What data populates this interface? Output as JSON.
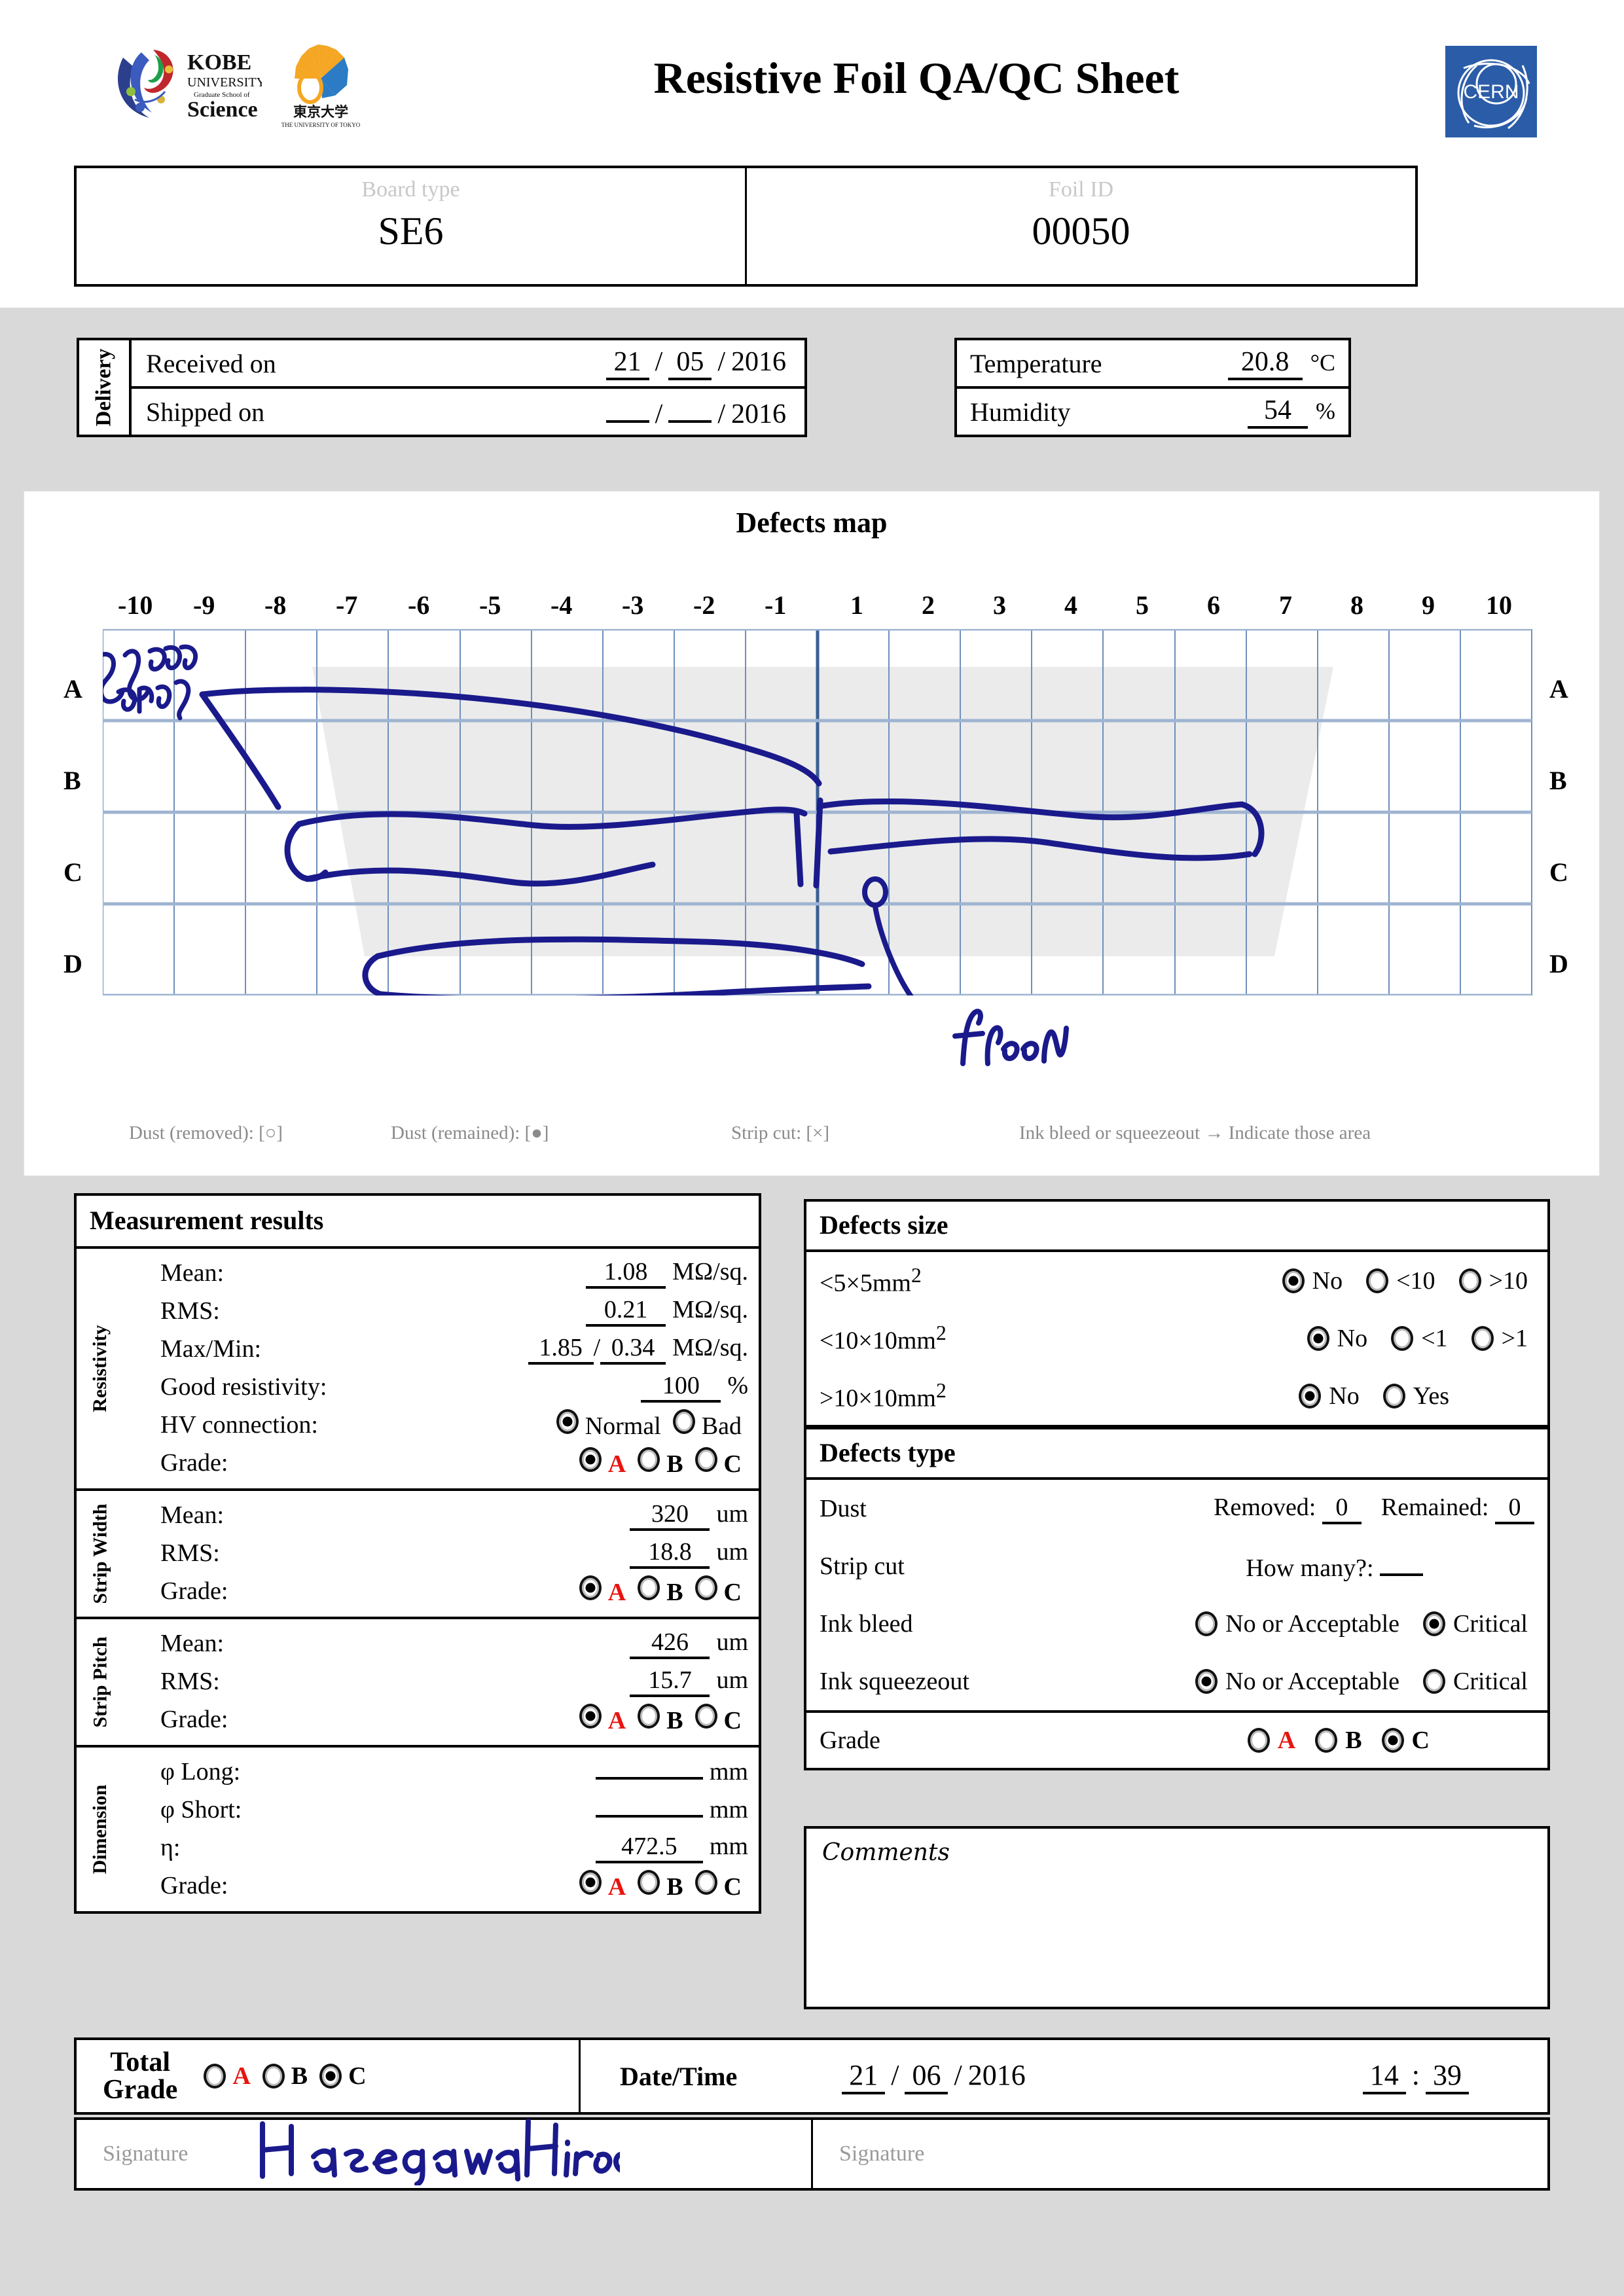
{
  "header": {
    "title": "Resistive Foil QA/QC Sheet",
    "logos": {
      "kobe": "KOBE UNIVERSITY Graduate School of Science",
      "tokyo": "THE UNIVERSITY OF TOKYO",
      "cern": "CERN"
    }
  },
  "identification": {
    "board_type_label": "Board type",
    "board_type_value": "SE6",
    "foil_id_label": "Foil ID",
    "foil_id_value": "00050"
  },
  "delivery": {
    "tab_label": "Delivery",
    "received_label": "Received on",
    "received_day": "21",
    "received_month": "05",
    "received_year": "2016",
    "shipped_label": "Shipped on",
    "shipped_day": "",
    "shipped_month": "",
    "shipped_year": "2016"
  },
  "environment": {
    "temperature_label": "Temperature",
    "temperature_value": "20.8",
    "temperature_unit": "°C",
    "humidity_label": "Humidity",
    "humidity_value": "54",
    "humidity_unit": "%"
  },
  "defects_map": {
    "title": "Defects map",
    "columns": [
      "-10",
      "-9",
      "-8",
      "-7",
      "-6",
      "-5",
      "-4",
      "-3",
      "-2",
      "-1",
      "1",
      "2",
      "3",
      "4",
      "5",
      "6",
      "7",
      "8",
      "9",
      "10"
    ],
    "rows": [
      "A",
      "B",
      "C",
      "D"
    ],
    "legend": [
      "Dust (removed): [○]",
      "Dust (remained): [●]",
      "Strip cut: [×]",
      "Ink bleed or squeezeout → Indicate those area"
    ],
    "annotations": [
      {
        "text": "squeeze out",
        "position": "row-A-left"
      },
      {
        "text": "fleen",
        "position": "below-row-D-center"
      }
    ]
  },
  "measurement": {
    "heading": "Measurement results",
    "resistivity": {
      "tab_label": "Resistivity",
      "mean_label": "Mean:",
      "mean_value": "1.08",
      "mean_unit": "MΩ/sq.",
      "rms_label": "RMS:",
      "rms_value": "0.21",
      "rms_unit": "MΩ/sq.",
      "maxmin_label": "Max/Min:",
      "max_value": "1.85",
      "min_value": "0.34",
      "maxmin_unit": "MΩ/sq.",
      "good_label": "Good resistivity:",
      "good_value": "100",
      "good_unit": "%",
      "hv_label": "HV connection:",
      "hv_options": [
        "Normal",
        "Bad"
      ],
      "hv_selected": "Normal",
      "grade_label": "Grade:",
      "grade_options": [
        "A",
        "B",
        "C"
      ],
      "grade_selected": "A"
    },
    "strip_width": {
      "tab_label": "Strip Width",
      "mean_label": "Mean:",
      "mean_value": "320",
      "mean_unit": "um",
      "rms_label": "RMS:",
      "rms_value": "18.8",
      "rms_unit": "um",
      "grade_label": "Grade:",
      "grade_options": [
        "A",
        "B",
        "C"
      ],
      "grade_selected": "A"
    },
    "strip_pitch": {
      "tab_label": "Strip Pitch",
      "mean_label": "Mean:",
      "mean_value": "426",
      "mean_unit": "um",
      "rms_label": "RMS:",
      "rms_value": "15.7",
      "rms_unit": "um",
      "grade_label": "Grade:",
      "grade_options": [
        "A",
        "B",
        "C"
      ],
      "grade_selected": "A"
    },
    "dimension": {
      "tab_label": "Dimension",
      "long_label": "φ Long:",
      "long_value": "",
      "long_unit": "mm",
      "short_label": "φ Short:",
      "short_value": "",
      "short_unit": "mm",
      "eta_label": "η:",
      "eta_value": "472.5",
      "eta_unit": "mm",
      "grade_label": "Grade:",
      "grade_options": [
        "A",
        "B",
        "C"
      ],
      "grade_selected": "A"
    }
  },
  "defects_size": {
    "heading": "Defects size",
    "rows": [
      {
        "label": "<5×5mm",
        "sup": "2",
        "options": [
          "No",
          "<10",
          ">10"
        ],
        "selected": "No"
      },
      {
        "label": "<10×10mm",
        "sup": "2",
        "options": [
          "No",
          "<1",
          ">1"
        ],
        "selected": "No"
      },
      {
        "label": ">10×10mm",
        "sup": "2",
        "options": [
          "No",
          "Yes"
        ],
        "selected": "No"
      }
    ]
  },
  "defects_type": {
    "heading": "Defects type",
    "dust_label": "Dust",
    "dust_removed_label": "Removed:",
    "dust_removed_value": "0",
    "dust_remained_label": "Remained:",
    "dust_remained_value": "0",
    "stripcut_label": "Strip cut",
    "stripcut_howmany_label": "How many?:",
    "stripcut_howmany_value": "",
    "inkbleed_label": "Ink bleed",
    "inkbleed_options": [
      "No or Acceptable",
      "Critical"
    ],
    "inkbleed_selected": "Critical",
    "inksqueeze_label": "Ink squeezeout",
    "inksqueeze_options": [
      "No or Acceptable",
      "Critical"
    ],
    "inksqueeze_selected": "No or Acceptable",
    "grade_label": "Grade",
    "grade_options": [
      "A",
      "B",
      "C"
    ],
    "grade_selected": "C"
  },
  "comments": {
    "label": "Comments",
    "value": ""
  },
  "footer": {
    "total_grade_line1": "Total",
    "total_grade_line2": "Grade",
    "total_grade_options": [
      "A",
      "B",
      "C"
    ],
    "total_grade_selected": "C",
    "datetime_label": "Date/Time",
    "date_day": "21",
    "date_month": "06",
    "date_year": "2016",
    "time_hour": "14",
    "time_minute": "39",
    "signature_label_left": "Signature",
    "signature_value_left": "Hasegawa Hiroki",
    "signature_label_right": "Signature",
    "signature_value_right": ""
  },
  "colors": {
    "grade_a_red": "#e8140f",
    "ink_blue": "#1a1a8c",
    "cern_blue": "#2b5ca8",
    "page_gray": "#d9d9d9"
  }
}
